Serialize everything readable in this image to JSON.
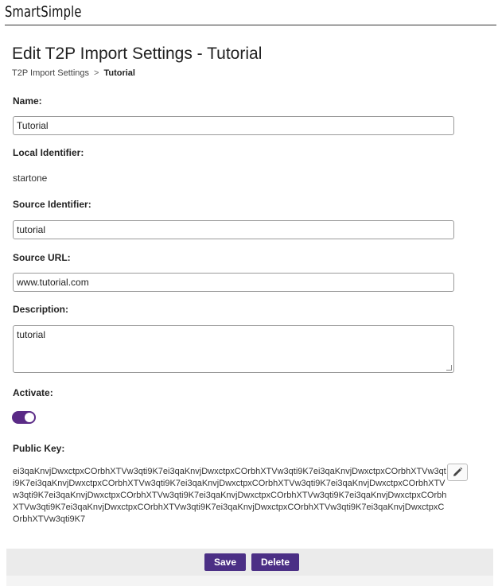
{
  "brand": "SmartSimple",
  "page": {
    "title": "Edit T2P Import Settings - Tutorial",
    "breadcrumb": {
      "parent": "T2P Import Settings",
      "separator": ">",
      "current": "Tutorial"
    }
  },
  "form": {
    "name_label": "Name:",
    "name_value": "Tutorial",
    "local_identifier_label": "Local Identifier:",
    "local_identifier_value": "startone",
    "source_identifier_label": "Source Identifier:",
    "source_identifier_value": "tutorial",
    "source_url_label": "Source URL:",
    "source_url_value": "www.tutorial.com",
    "description_label": "Description:",
    "description_value": "tutorial",
    "activate_label": "Activate:",
    "activate_on": true,
    "public_key_label": "Public Key:",
    "public_key_value": "ei3qaKnvjDwxctpxCOrbhXTVw3qti9K7ei3qaKnvjDwxctpxCOrbhXTVw3qti9K7ei3qaKnvjDwxctpxCOrbhXTVw3qti9K7ei3qaKnvjDwxctpxCOrbhXTVw3qti9K7ei3qaKnvjDwxctpxCOrbhXTVw3qti9K7ei3qaKnvjDwxctpxCOrbhXTVw3qti9K7ei3qaKnvjDwxctpxCOrbhXTVw3qti9K7ei3qaKnvjDwxctpxCOrbhXTVw3qti9K7ei3qaKnvjDwxctpxCOrbhXTVw3qti9K7ei3qaKnvjDwxctpxCOrbhXTVw3qti9K7ei3qaKnvjDwxctpxCOrbhXTVw3qti9K7ei3qaKnvjDwxctpxCOrbhXTVw3qti9K7",
    "edit_icon": "pencil-icon"
  },
  "actions": {
    "save_label": "Save",
    "delete_label": "Delete"
  },
  "colors": {
    "accent": "#4b2f85",
    "toggle_on": "#5a2a86"
  }
}
